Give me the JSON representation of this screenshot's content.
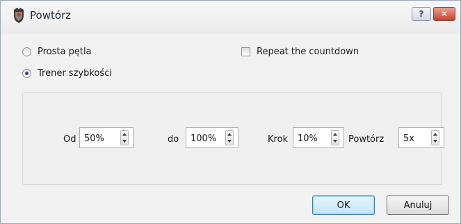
{
  "window": {
    "title": "Powtórz",
    "help_label": "?",
    "close_label": "✕"
  },
  "mode": {
    "simple_loop_label": "Prosta pętla",
    "simple_loop_checked": false,
    "speed_trainer_label": "Trener szybkości",
    "speed_trainer_checked": true
  },
  "countdown": {
    "label": "Repeat the countdown",
    "checked": false
  },
  "fields": {
    "from_label": "Od",
    "from_value": "50%",
    "to_label": "do",
    "to_value": "100%",
    "step_label": "Krok",
    "step_value": "10%",
    "repeat_label": "Powtórz",
    "repeat_value": "5x"
  },
  "buttons": {
    "ok_label": "OK",
    "cancel_label": "Anuluj"
  }
}
